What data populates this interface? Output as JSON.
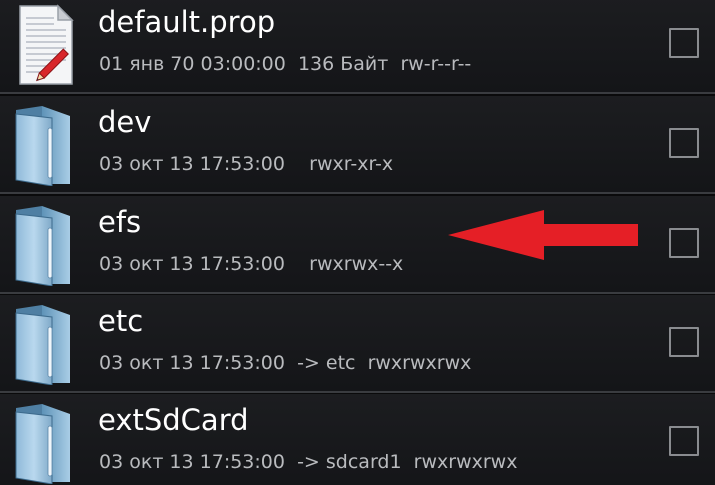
{
  "files": [
    {
      "name": "default.prop",
      "date": "01 янв 70 03:00:00",
      "info": "136 Байт",
      "perms": "rw-r--r--",
      "icon": "text-file-icon"
    },
    {
      "name": "dev",
      "date": "03 окт 13 17:53:00",
      "info": "",
      "perms": "rwxr-xr-x",
      "icon": "folder-icon"
    },
    {
      "name": "efs",
      "date": "03 окт 13 17:53:00",
      "info": "",
      "perms": "rwxrwx--x",
      "icon": "folder-icon"
    },
    {
      "name": "etc",
      "date": "03 окт 13 17:53:00",
      "info": "-> etc",
      "perms": "rwxrwxrwx",
      "icon": "folder-icon"
    },
    {
      "name": "extSdCard",
      "date": "03 окт 13 17:53:00",
      "info": "-> sdcard1",
      "perms": "rwxrwxrwx",
      "icon": "folder-icon"
    }
  ],
  "annotation": {
    "icon": "red-arrow-icon",
    "color": "#e51f26",
    "target": "efs"
  },
  "colors": {
    "background": "#141518",
    "divider": "#3a3c40",
    "name_text": "#ffffff",
    "meta_text": "#b9bbbe"
  }
}
